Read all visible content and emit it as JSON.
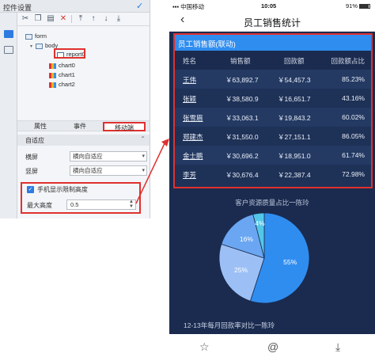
{
  "panel": {
    "title": "控件设置",
    "toolbar_icons": [
      "cut-icon",
      "copy-icon",
      "paste-icon",
      "delete-icon",
      "move-top-icon",
      "move-up-icon",
      "move-down-icon",
      "move-bottom-icon"
    ],
    "tree": {
      "root": "form",
      "body": "body",
      "selected": "report0",
      "children": [
        "chart0",
        "chart1",
        "chart2"
      ]
    },
    "tabs": [
      "属性",
      "事件",
      "移动端"
    ],
    "adapt_section": "自适应",
    "horizontal_label": "横屏",
    "horizontal_value": "横向自适应",
    "vertical_label": "竖屏",
    "vertical_value": "横向自适应",
    "limit_height_label": "手机显示限制高度",
    "max_height_label": "最大高度",
    "max_height_value": "0.5"
  },
  "phone": {
    "status": {
      "carrier": "中国移动",
      "time": "10:05",
      "battery": "91%"
    },
    "nav_title": "员工销售统计",
    "report": {
      "title": "员工销售额(联动)",
      "headers": [
        "姓名",
        "销售额",
        "回款额",
        "回款额占比"
      ],
      "rows": [
        [
          "王伟",
          "￥63,892.7",
          "￥54,457.3",
          "85.23%"
        ],
        [
          "张颖",
          "￥38,580.9",
          "￥16,651.7",
          "43.16%"
        ],
        [
          "张雪眉",
          "￥33,063.1",
          "￥19,843.2",
          "60.02%"
        ],
        [
          "郑建杰",
          "￥31,550.0",
          "￥27,151.1",
          "86.05%"
        ],
        [
          "金士鹏",
          "￥30,696.2",
          "￥18,951.0",
          "61.74%"
        ],
        [
          "李芳",
          "￥30,676.4",
          "￥22,387.4",
          "72.98%"
        ]
      ]
    },
    "pie_title": "客户资源质量占比一陈玲",
    "next_title": "12-13年每月回款率对比一陈玲",
    "bottom_icons": [
      "star-icon",
      "at-icon",
      "download-icon"
    ]
  },
  "chart_data": {
    "type": "pie",
    "title": "客户资源质量占比一陈玲",
    "slices": [
      {
        "label": "55%",
        "value": 55,
        "color": "#2f8df0"
      },
      {
        "label": "25%",
        "value": 25,
        "color": "#9cc0f5"
      },
      {
        "label": "16%",
        "value": 16,
        "color": "#6aa6f2"
      },
      {
        "label": "4%",
        "value": 4,
        "color": "#52c7e8"
      }
    ]
  }
}
